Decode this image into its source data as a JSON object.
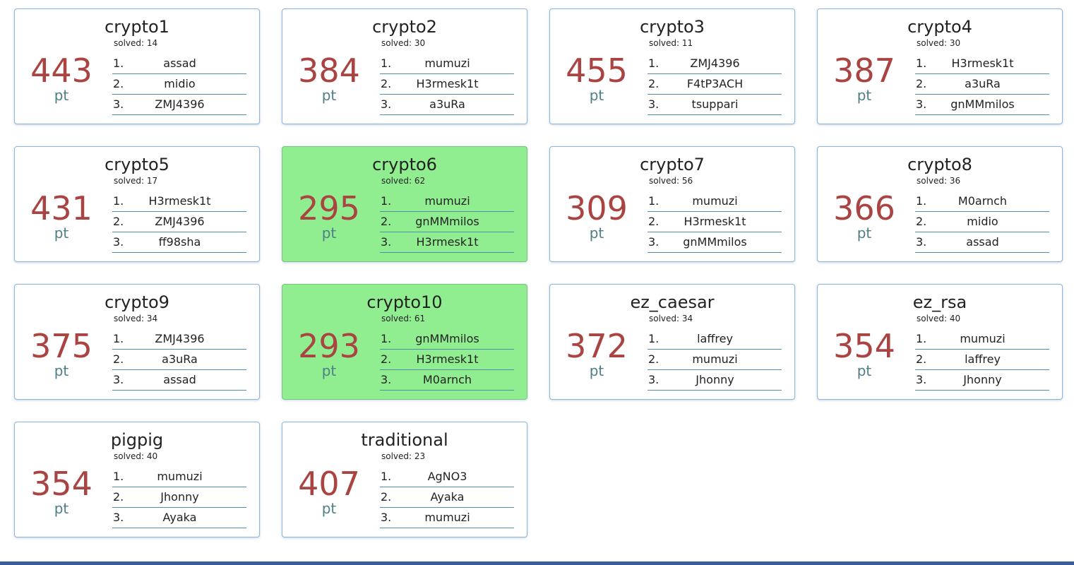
{
  "challenges": [
    {
      "name": "crypto1",
      "solved": "solved: 14",
      "points": "443",
      "unit": "pt",
      "solved_by_me": false,
      "ranking": [
        {
          "rank": "1.",
          "user": "assad"
        },
        {
          "rank": "2.",
          "user": "midio"
        },
        {
          "rank": "3.",
          "user": "ZMJ4396"
        }
      ]
    },
    {
      "name": "crypto2",
      "solved": "solved: 30",
      "points": "384",
      "unit": "pt",
      "solved_by_me": false,
      "ranking": [
        {
          "rank": "1.",
          "user": "mumuzi"
        },
        {
          "rank": "2.",
          "user": "H3rmesk1t"
        },
        {
          "rank": "3.",
          "user": "a3uRa"
        }
      ]
    },
    {
      "name": "crypto3",
      "solved": "solved: 11",
      "points": "455",
      "unit": "pt",
      "solved_by_me": false,
      "ranking": [
        {
          "rank": "1.",
          "user": "ZMJ4396"
        },
        {
          "rank": "2.",
          "user": "F4tP3ACH"
        },
        {
          "rank": "3.",
          "user": "tsuppari"
        }
      ]
    },
    {
      "name": "crypto4",
      "solved": "solved: 30",
      "points": "387",
      "unit": "pt",
      "solved_by_me": false,
      "ranking": [
        {
          "rank": "1.",
          "user": "H3rmesk1t"
        },
        {
          "rank": "2.",
          "user": "a3uRa"
        },
        {
          "rank": "3.",
          "user": "gnMMmilos"
        }
      ]
    },
    {
      "name": "crypto5",
      "solved": "solved: 17",
      "points": "431",
      "unit": "pt",
      "solved_by_me": false,
      "ranking": [
        {
          "rank": "1.",
          "user": "H3rmesk1t"
        },
        {
          "rank": "2.",
          "user": "ZMJ4396"
        },
        {
          "rank": "3.",
          "user": "ff98sha"
        }
      ]
    },
    {
      "name": "crypto6",
      "solved": "solved: 62",
      "points": "295",
      "unit": "pt",
      "solved_by_me": true,
      "ranking": [
        {
          "rank": "1.",
          "user": "mumuzi"
        },
        {
          "rank": "2.",
          "user": "gnMMmilos"
        },
        {
          "rank": "3.",
          "user": "H3rmesk1t"
        }
      ]
    },
    {
      "name": "crypto7",
      "solved": "solved: 56",
      "points": "309",
      "unit": "pt",
      "solved_by_me": false,
      "ranking": [
        {
          "rank": "1.",
          "user": "mumuzi"
        },
        {
          "rank": "2.",
          "user": "H3rmesk1t"
        },
        {
          "rank": "3.",
          "user": "gnMMmilos"
        }
      ]
    },
    {
      "name": "crypto8",
      "solved": "solved: 36",
      "points": "366",
      "unit": "pt",
      "solved_by_me": false,
      "ranking": [
        {
          "rank": "1.",
          "user": "M0arnch"
        },
        {
          "rank": "2.",
          "user": "midio"
        },
        {
          "rank": "3.",
          "user": "assad"
        }
      ]
    },
    {
      "name": "crypto9",
      "solved": "solved: 34",
      "points": "375",
      "unit": "pt",
      "solved_by_me": false,
      "ranking": [
        {
          "rank": "1.",
          "user": "ZMJ4396"
        },
        {
          "rank": "2.",
          "user": "a3uRa"
        },
        {
          "rank": "3.",
          "user": "assad"
        }
      ]
    },
    {
      "name": "crypto10",
      "solved": "solved: 61",
      "points": "293",
      "unit": "pt",
      "solved_by_me": true,
      "ranking": [
        {
          "rank": "1.",
          "user": "gnMMmilos"
        },
        {
          "rank": "2.",
          "user": "H3rmesk1t"
        },
        {
          "rank": "3.",
          "user": "M0arnch"
        }
      ]
    },
    {
      "name": "ez_caesar",
      "solved": "solved: 34",
      "points": "372",
      "unit": "pt",
      "solved_by_me": false,
      "ranking": [
        {
          "rank": "1.",
          "user": "laffrey"
        },
        {
          "rank": "2.",
          "user": "mumuzi"
        },
        {
          "rank": "3.",
          "user": "Jhonny"
        }
      ]
    },
    {
      "name": "ez_rsa",
      "solved": "solved: 40",
      "points": "354",
      "unit": "pt",
      "solved_by_me": false,
      "ranking": [
        {
          "rank": "1.",
          "user": "mumuzi"
        },
        {
          "rank": "2.",
          "user": "laffrey"
        },
        {
          "rank": "3.",
          "user": "Jhonny"
        }
      ]
    },
    {
      "name": "pigpig",
      "solved": "solved: 40",
      "points": "354",
      "unit": "pt",
      "solved_by_me": false,
      "ranking": [
        {
          "rank": "1.",
          "user": "mumuzi"
        },
        {
          "rank": "2.",
          "user": "Jhonny"
        },
        {
          "rank": "3.",
          "user": "Ayaka"
        }
      ]
    },
    {
      "name": "traditional",
      "solved": "solved: 23",
      "points": "407",
      "unit": "pt",
      "solved_by_me": false,
      "ranking": [
        {
          "rank": "1.",
          "user": "AgNO3"
        },
        {
          "rank": "2.",
          "user": "Ayaka"
        },
        {
          "rank": "3.",
          "user": "mumuzi"
        }
      ]
    }
  ],
  "colors": {
    "solved_card_bg": "#90ee90",
    "points_color": "#a94442",
    "unit_color": "#4f7f86",
    "card_border": "#8fb5d9",
    "footer_bar": "#3b5b9a"
  }
}
